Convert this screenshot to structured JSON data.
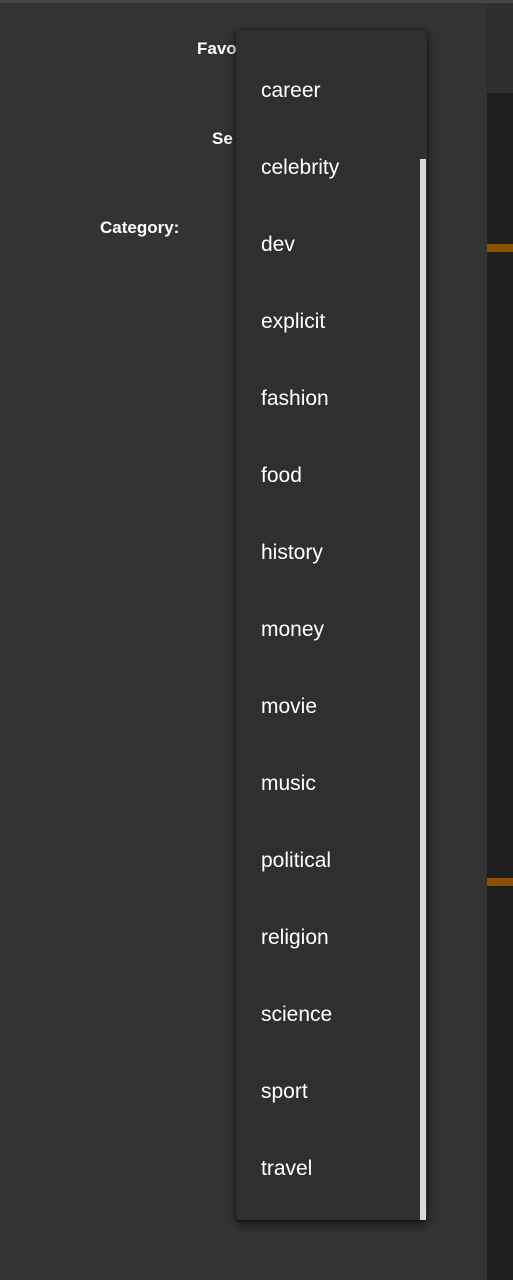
{
  "background_panel": {
    "accent_color": "#8a5200"
  },
  "filters": {
    "favorites_label": "Favo",
    "selection_label": "Se",
    "category_label": "Category:"
  },
  "category_dropdown": {
    "options": [
      {
        "label": "career"
      },
      {
        "label": "celebrity"
      },
      {
        "label": "dev"
      },
      {
        "label": "explicit"
      },
      {
        "label": "fashion"
      },
      {
        "label": "food"
      },
      {
        "label": "history"
      },
      {
        "label": "money"
      },
      {
        "label": "movie"
      },
      {
        "label": "music"
      },
      {
        "label": "political"
      },
      {
        "label": "religion"
      },
      {
        "label": "science"
      },
      {
        "label": "sport"
      },
      {
        "label": "travel"
      }
    ]
  }
}
